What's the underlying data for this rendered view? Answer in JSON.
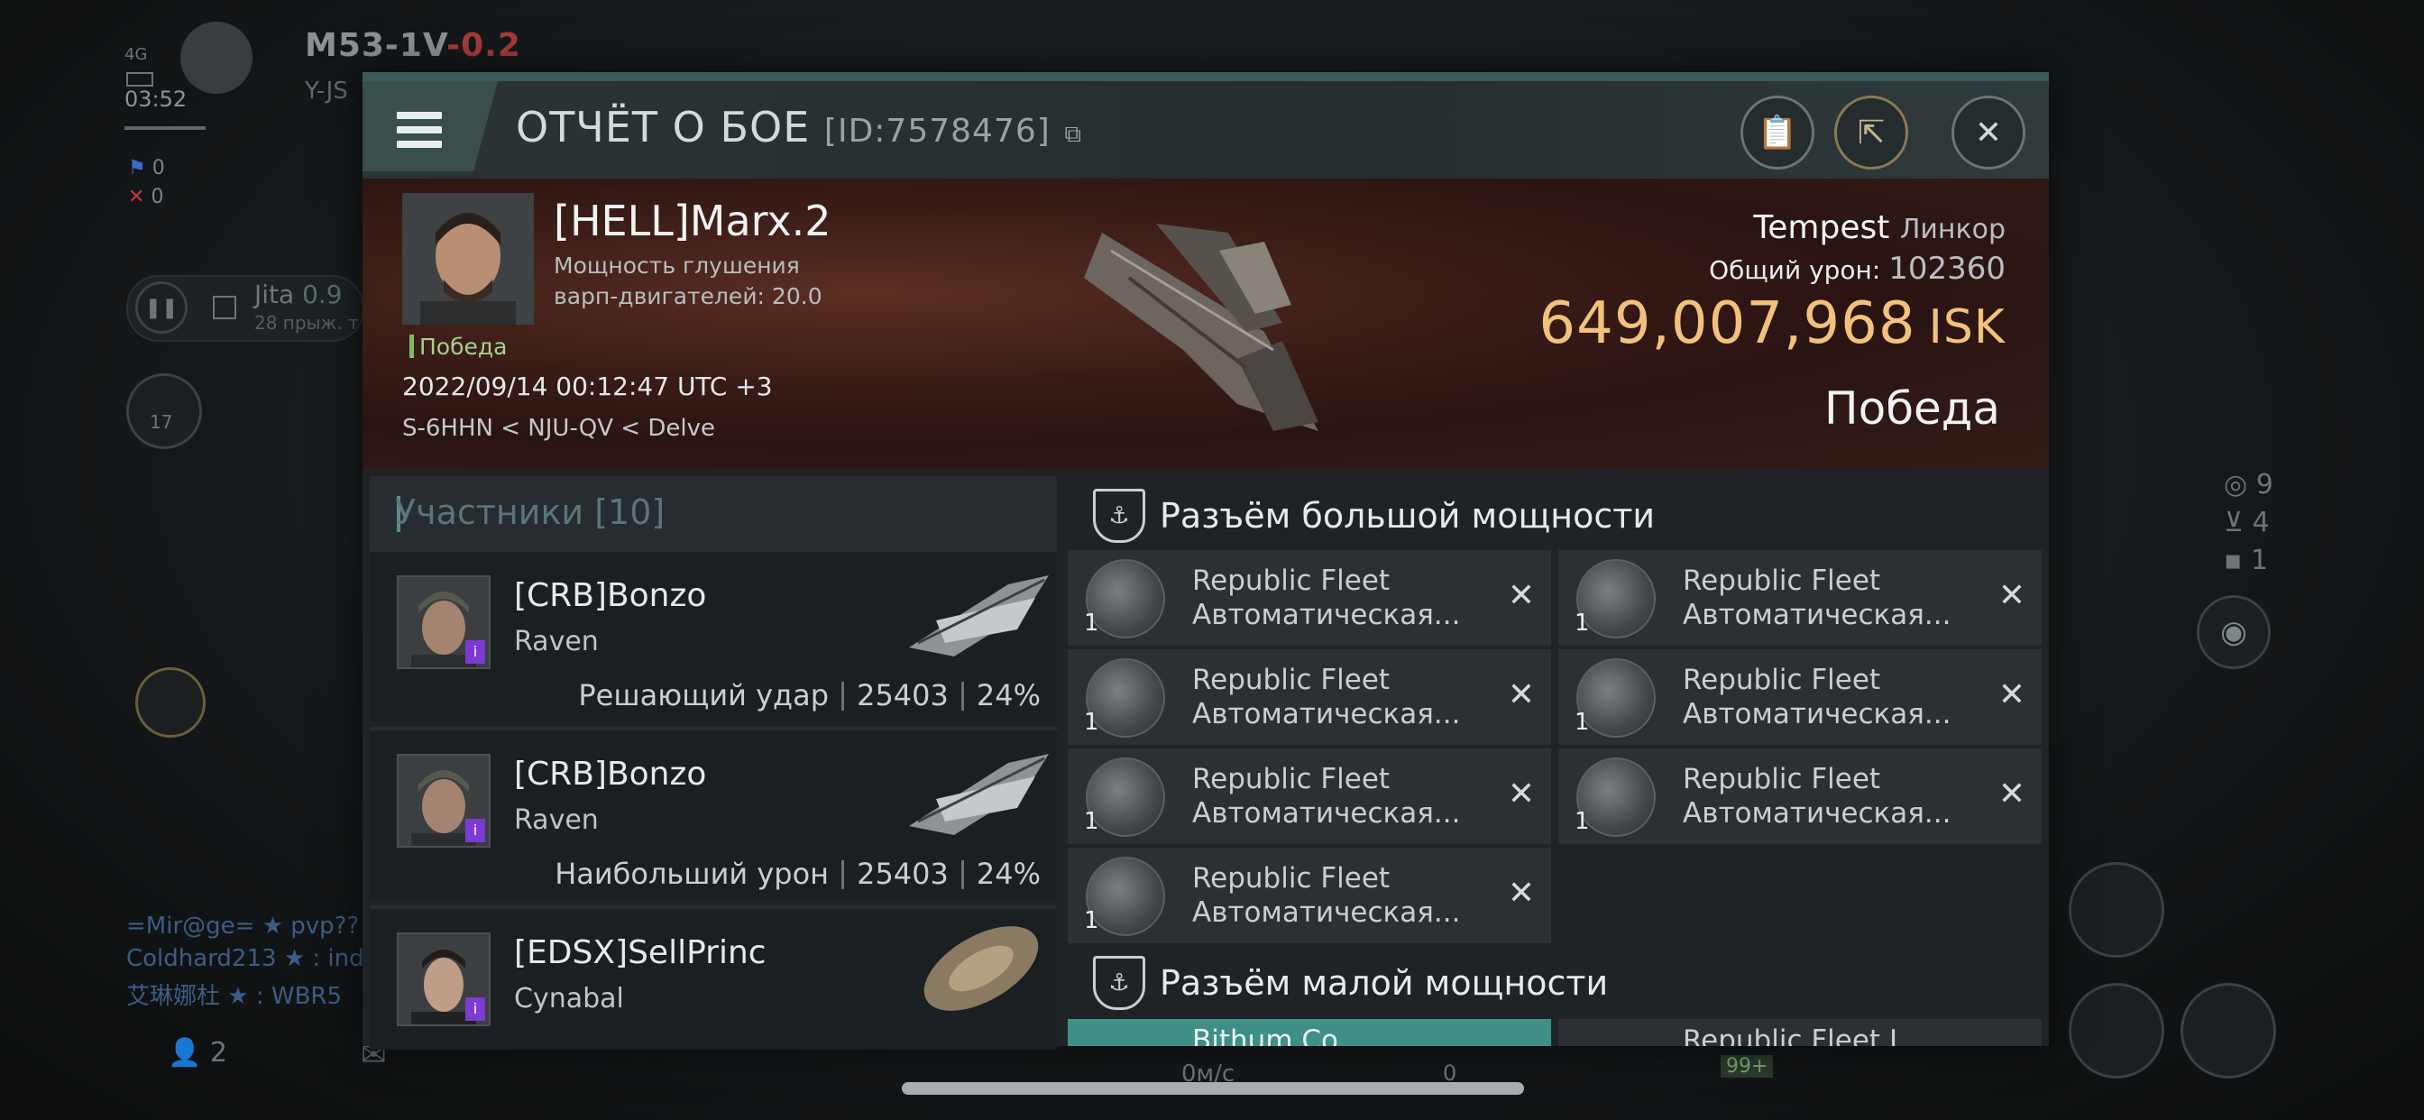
{
  "background": {
    "net": "4G",
    "time": "03:52",
    "system_name": "M53-1V",
    "system_sec": "-0.2",
    "system_sub": "Y-JS",
    "flags": [
      {
        "icon": "blue-flag-icon",
        "value": "0"
      },
      {
        "icon": "red-x-icon",
        "value": "0"
      }
    ],
    "jita_name": "Jita",
    "jita_sec": "0.9",
    "jita_sub": "28 прыж. т",
    "level_badge": "17",
    "right_counters": [
      {
        "icon": "target-icon",
        "value": "9"
      },
      {
        "icon": "drone-icon",
        "value": "4"
      },
      {
        "icon": "square-icon",
        "value": "1"
      }
    ],
    "chat": [
      {
        "name": "=Mir@ge=",
        "text": " pvp??"
      },
      {
        "name": "Coldhard213",
        "text": " : indy"
      },
      {
        "name": "艾琳娜杜",
        "text": " : WBR5"
      }
    ],
    "bottom_left_count": "2",
    "speed": "0м/с",
    "speed_right": "0",
    "badge_99": "99+"
  },
  "dialog": {
    "title": "ОТЧЁТ О БОЕ",
    "report_id": "[ID:7578476]",
    "pilot": {
      "name": "[HELL]Marx.2",
      "line1": "Мощность глушения",
      "line2": "варп-двигателей: 20.0",
      "status": "Победа",
      "date": "2022/09/14 00:12:47 UTC +3",
      "location": "S-6HHN < NJU-QV < Delve"
    },
    "ship": {
      "name": "Tempest",
      "class": "Линкор",
      "damage_label": "Общий урон:",
      "damage_value": "102360",
      "isk_value": "649,007,968",
      "isk_unit": "ISK",
      "result": "Победа"
    },
    "participants": {
      "label": "Участники",
      "count": "[10]",
      "items": [
        {
          "name": "[CRB]Bonzo",
          "ship": "Raven",
          "role": "Решающий удар",
          "damage": "25403",
          "percent": "24%"
        },
        {
          "name": "[CRB]Bonzo",
          "ship": "Raven",
          "role": "Наибольший урон",
          "damage": "25403",
          "percent": "24%"
        },
        {
          "name": "[EDSX]SellPrinc",
          "ship": "Cynabal",
          "role": "",
          "damage": "",
          "percent": ""
        }
      ]
    },
    "high_slots": {
      "title": "Разъём большой мощности",
      "modules": [
        {
          "qty": "1",
          "name": "Republic Fleet",
          "type": "Автоматическая..."
        },
        {
          "qty": "1",
          "name": "Republic Fleet",
          "type": "Автоматическая..."
        },
        {
          "qty": "1",
          "name": "Republic Fleet",
          "type": "Автоматическая..."
        },
        {
          "qty": "1",
          "name": "Republic Fleet",
          "type": "Автоматическая..."
        },
        {
          "qty": "1",
          "name": "Republic Fleet",
          "type": "Автоматическая..."
        },
        {
          "qty": "1",
          "name": "Republic Fleet",
          "type": "Автоматическая..."
        },
        {
          "qty": "1",
          "name": "Republic Fleet",
          "type": "Автоматическая..."
        }
      ]
    },
    "low_slots": {
      "title": "Разъём малой мощности",
      "partial": [
        "Bithum Co...",
        "Republic Fleet L..."
      ]
    }
  }
}
